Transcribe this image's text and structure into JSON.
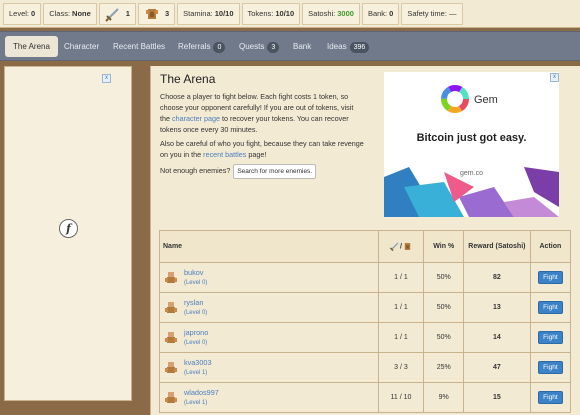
{
  "status": {
    "level_label": "Level:",
    "level": "0",
    "class_label": "Class:",
    "class": "None",
    "sword_count": "1",
    "armor_count": "3",
    "stamina_label": "Stamina:",
    "stamina": "10/10",
    "tokens_label": "Tokens:",
    "tokens": "10/10",
    "satoshi_label": "Satoshi:",
    "satoshi": "3000",
    "bank_label": "Bank:",
    "bank": "0",
    "safety_label": "Safety time:",
    "safety": "—"
  },
  "nav": {
    "arena": "The Arena",
    "character": "Character",
    "recent_battles": "Recent Battles",
    "referrals": "Referrals",
    "referrals_count": "0",
    "quests": "Quests",
    "quests_count": "3",
    "bank": "Bank",
    "ideas": "Ideas",
    "ideas_count": "396"
  },
  "main": {
    "title": "The Arena",
    "p1_a": "Choose a player to fight below. Each fight costs 1 token, so choose your opponent carefully! If you are out of tokens, visit the ",
    "p1_link": "character page",
    "p1_b": " to recover your tokens. You can recover tokens once every 30 minutes.",
    "p2_a": "Also be careful of who you fight, because they can take revenge on you in the ",
    "p2_link": "recent battles",
    "p2_b": " page!",
    "enemies_text": "Not enough enemies?",
    "search_button": "Search for more enemies."
  },
  "ad": {
    "brand": "Gem",
    "tagline": "Bitcoin just got easy.",
    "url": "gem.co"
  },
  "table": {
    "headers": {
      "name": "Name",
      "vs_sep": "/",
      "win": "Win %",
      "reward": "Reward (Satoshi)",
      "action": "Action"
    },
    "rows": [
      {
        "name": "bukov",
        "level": "(Level 0)",
        "record": "1 / 1",
        "win": "50%",
        "reward": "82",
        "action": "Fight"
      },
      {
        "name": "ryslan",
        "level": "(Level 0)",
        "record": "1 / 1",
        "win": "50%",
        "reward": "13",
        "action": "Fight"
      },
      {
        "name": "japrono",
        "level": "(Level 0)",
        "record": "1 / 1",
        "win": "50%",
        "reward": "14",
        "action": "Fight"
      },
      {
        "name": "kva3003",
        "level": "(Level 1)",
        "record": "3 / 3",
        "win": "25%",
        "reward": "47",
        "action": "Fight"
      },
      {
        "name": "wlados997",
        "level": "(Level 1)",
        "record": "11 / 10",
        "win": "9%",
        "reward": "15",
        "action": "Fight"
      }
    ]
  },
  "colors": {
    "accent": "#3b82c8",
    "reward": "#3a9a2a",
    "win_mid": "#b9882f",
    "win_bad": "#cc3333"
  }
}
